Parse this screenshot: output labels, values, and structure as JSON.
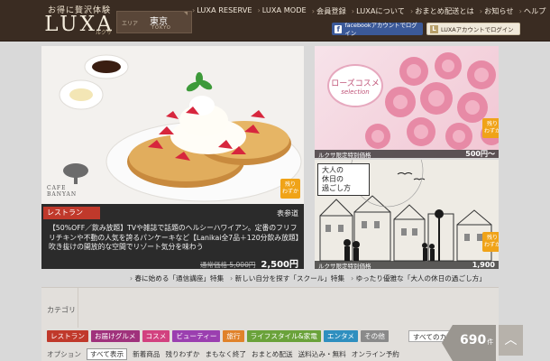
{
  "header": {
    "logo_tag": "お得に贅沢体験",
    "logo": "LUXA",
    "logo_sub": "ルクサ",
    "area_label": "エリア",
    "area_name": "東京",
    "area_en": "TOKYO",
    "nav": [
      "LUXA RESERVE",
      "LUXA MODE",
      "会員登録",
      "LUXAについて",
      "おまとめ配送とは",
      "お知らせ",
      "ヘルプ"
    ],
    "fb_login": "facebookアカウントでログイン",
    "luxa_login": "LUXAアカウントでログイン"
  },
  "featured": {
    "cafe_name": "CAFE BANYAN",
    "category": "レストラン",
    "location": "表参道",
    "description": "【50%OFF／飲み放題】TVや雑誌で話題のヘルシーハワイアン。定番のフリフリチキンや不動の人気を誇るパンケーキなど【Lanikai全7品＋120分飲み放題】吹き抜けの開放的な空間でリゾート気分を味わう",
    "regular_price": "通常価格 5,000円",
    "sale_price": "2,500円",
    "badge": [
      "残り",
      "わずか"
    ]
  },
  "tiles": [
    {
      "title": "ローズコスメ",
      "subtitle": "selection",
      "bar_text": "ルクサ限定特別価格",
      "price": "500円～",
      "badge": [
        "残り",
        "わずか"
      ]
    },
    {
      "title": [
        "大人の",
        "休日の",
        "過ごし方"
      ],
      "bar_text": "ルクサ限定特別価格",
      "price": "1,900",
      "badge": [
        "残り",
        "わずか"
      ]
    }
  ],
  "features": [
    "春に始める「通信講座」特集",
    "新しい自分を探す「スクール」特集",
    "ゆったり優雅な「大人の休日の過ごし方」"
  ],
  "search": {
    "category_label": "カテゴリ",
    "chips": [
      {
        "label": "レストラン",
        "color": "#c0392b"
      },
      {
        "label": "お届けグルメ",
        "color": "#a0327c"
      },
      {
        "label": "コスメ",
        "color": "#d2417f"
      },
      {
        "label": "ビューティー",
        "color": "#9b3fb0"
      },
      {
        "label": "旅行",
        "color": "#e0822a"
      },
      {
        "label": "ライフスタイル&家電",
        "color": "#6aa23a"
      },
      {
        "label": "エンタメ",
        "color": "#2f8fbf"
      },
      {
        "label": "その他",
        "color": "#8a8a8a"
      }
    ],
    "all_categories": "すべてのカテ",
    "option_label": "オプション",
    "options": [
      "すべて表示",
      "新着商品",
      "残りわずか",
      "まもなく終了",
      "おまとめ配送",
      "送料込み・無料",
      "オンライン予約"
    ],
    "count": "690",
    "count_unit": "件"
  }
}
